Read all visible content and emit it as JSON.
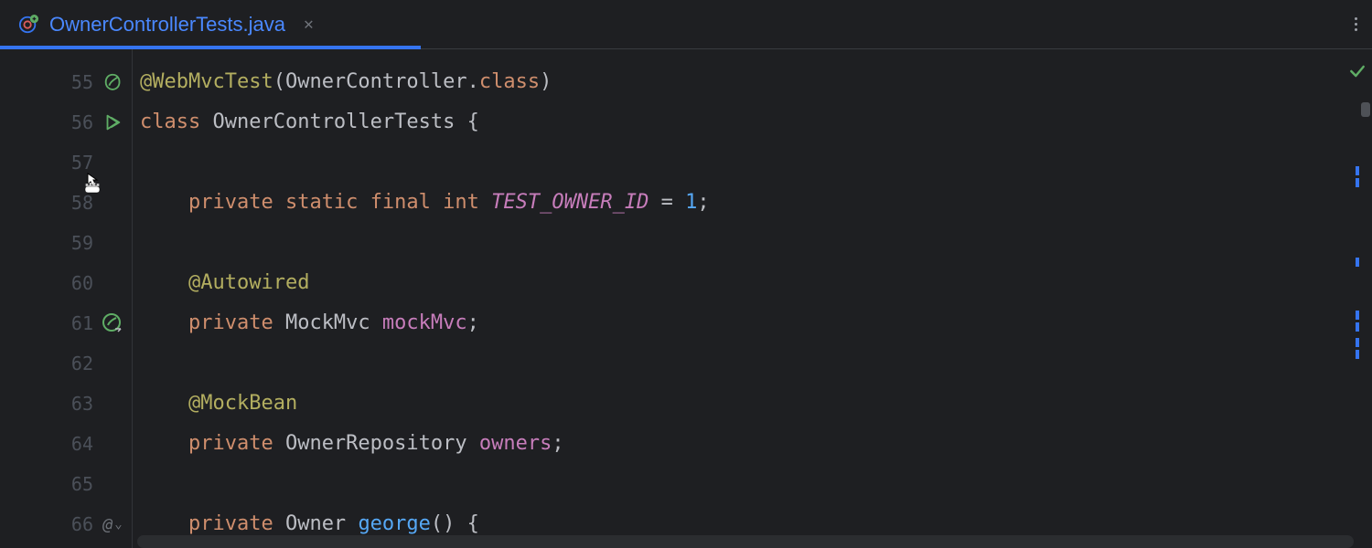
{
  "tab": {
    "title": "OwnerControllerTests.java"
  },
  "gutter": {
    "start": 55,
    "lines": [
      55,
      56,
      57,
      58,
      59,
      60,
      61,
      62,
      63,
      64,
      65,
      66
    ]
  },
  "code": {
    "l55": {
      "annotation": "@WebMvcTest",
      "arg_class": "OwnerController",
      "kw_class": "class"
    },
    "l56": {
      "kw_class": "class",
      "classname": "OwnerControllerTests"
    },
    "l58": {
      "kw_private": "private",
      "kw_static": "static",
      "kw_final": "final",
      "kw_int": "int",
      "field": "TEST_OWNER_ID",
      "eq": " = ",
      "value": "1"
    },
    "l60": {
      "annotation": "@Autowired"
    },
    "l61": {
      "kw_private": "private",
      "type": "MockMvc",
      "field": "mockMvc"
    },
    "l63": {
      "annotation": "@MockBean"
    },
    "l64": {
      "kw_private": "private",
      "type": "OwnerRepository",
      "field": "owners"
    },
    "l66": {
      "kw_private": "private",
      "type": "Owner",
      "method": "george"
    }
  }
}
